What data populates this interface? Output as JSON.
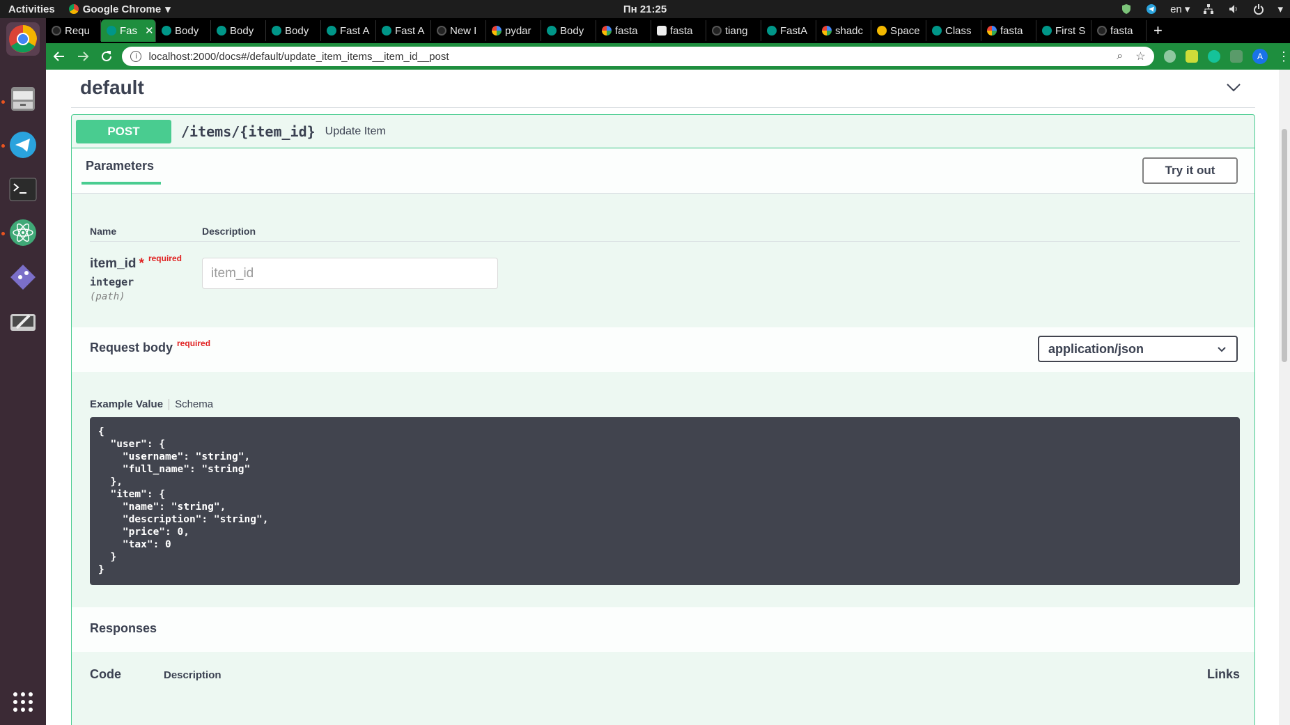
{
  "os": {
    "activities": "Activities",
    "app_name": "Google Chrome",
    "clock": "Пн 21:25",
    "language": "en"
  },
  "browser": {
    "tabs": [
      {
        "label": "Requ",
        "icon": "github-icon"
      },
      {
        "label": "Fas",
        "icon": "fastapi-icon",
        "active": true
      },
      {
        "label": "Body",
        "icon": "fastapi-icon"
      },
      {
        "label": "Body",
        "icon": "fastapi-icon"
      },
      {
        "label": "Body",
        "icon": "fastapi-icon"
      },
      {
        "label": "Fast A",
        "icon": "fastapi-icon"
      },
      {
        "label": "Fast A",
        "icon": "fastapi-icon"
      },
      {
        "label": "New I",
        "icon": "github-icon"
      },
      {
        "label": "pydar",
        "icon": "google-icon"
      },
      {
        "label": "Body",
        "icon": "fastapi-icon"
      },
      {
        "label": "fasta",
        "icon": "google-icon"
      },
      {
        "label": "fasta",
        "icon": "hexagon-icon"
      },
      {
        "label": "tiang",
        "icon": "github-icon"
      },
      {
        "label": "FastA",
        "icon": "fastapi-icon"
      },
      {
        "label": "shadc",
        "icon": "google-icon"
      },
      {
        "label": "Space",
        "icon": "hn-icon"
      },
      {
        "label": "Class",
        "icon": "fastapi-icon"
      },
      {
        "label": "fasta",
        "icon": "google-icon"
      },
      {
        "label": "First S",
        "icon": "fastapi-icon"
      },
      {
        "label": "fasta",
        "icon": "github-icon"
      }
    ],
    "url": "localhost:2000/docs#/default/update_item_items__item_id__post"
  },
  "page": {
    "tag": "default",
    "operation": {
      "method": "POST",
      "path": "/items/{item_id}",
      "summary": "Update Item"
    },
    "parameters": {
      "title": "Parameters",
      "try_button": "Try it out",
      "col_name": "Name",
      "col_description": "Description",
      "param": {
        "name": "item_id",
        "star": "*",
        "required": "required",
        "type": "integer",
        "in": "(path)",
        "placeholder": "item_id"
      }
    },
    "request_body": {
      "title": "Request body",
      "required": "required",
      "content_type": "application/json",
      "tab_example": "Example Value",
      "tab_schema": "Schema",
      "example": "{\n  \"user\": {\n    \"username\": \"string\",\n    \"full_name\": \"string\"\n  },\n  \"item\": {\n    \"name\": \"string\",\n    \"description\": \"string\",\n    \"price\": 0,\n    \"tax\": 0\n  }\n}"
    },
    "responses": {
      "title": "Responses",
      "col_code": "Code",
      "col_description": "Description",
      "col_links": "Links"
    }
  }
}
